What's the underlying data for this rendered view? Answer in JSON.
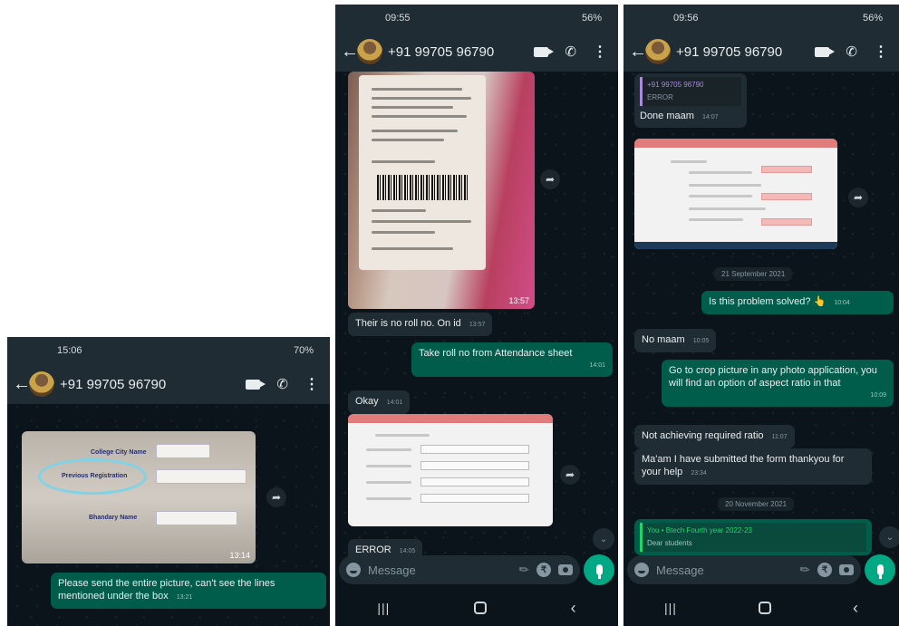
{
  "contact": "+91 99705 96790",
  "composer_placeholder": "Message",
  "phone1": {
    "status_time": "15:06",
    "status_battery": "70%",
    "image_time": "13:14",
    "form_labels": [
      "College City Name",
      "Previous Registration",
      "Bhandary Name"
    ],
    "message_out": {
      "text": "Please send the entire picture, can't see the lines mentioned under the box",
      "time": "13:21"
    }
  },
  "phone2": {
    "status_time": "09:55",
    "status_battery": "56%",
    "image_time": "13:57",
    "messages": [
      {
        "text": "Their is no roll no. On id",
        "time": "13:57"
      },
      {
        "text": "Take roll no from Attendance sheet",
        "time": "14:01"
      },
      {
        "text": "Okay",
        "time": "14:01"
      },
      {
        "text": "ERROR",
        "time": "14:05"
      }
    ]
  },
  "phone3": {
    "status_time": "09:56",
    "status_battery": "56%",
    "quote_name": "+91 99705 96790",
    "quote_text": "ERROR",
    "date1": "21 September 2021",
    "date2": "20 November 2021",
    "messages": [
      {
        "text": "Done maam",
        "time": "14:07"
      },
      {
        "text": "Is this problem solved? 👆",
        "time": "10:04"
      },
      {
        "text": "No maam",
        "time": "10:05"
      },
      {
        "text": "Go to crop picture in any photo application, you will find an option of aspect ratio in that",
        "time": "10:09"
      },
      {
        "text": "Not achieving required ratio",
        "time": "11:07"
      },
      {
        "text": "Ma'am I have submitted the form thankyou for your help",
        "time": "23:34"
      }
    ],
    "forward_header": "You • Btech Fourth year 2022-23",
    "forward_text": "Dear students"
  },
  "colors": {
    "background": "#0b141a",
    "incoming": "#202c33",
    "outgoing": "#005c4b",
    "accent": "#00a884"
  }
}
